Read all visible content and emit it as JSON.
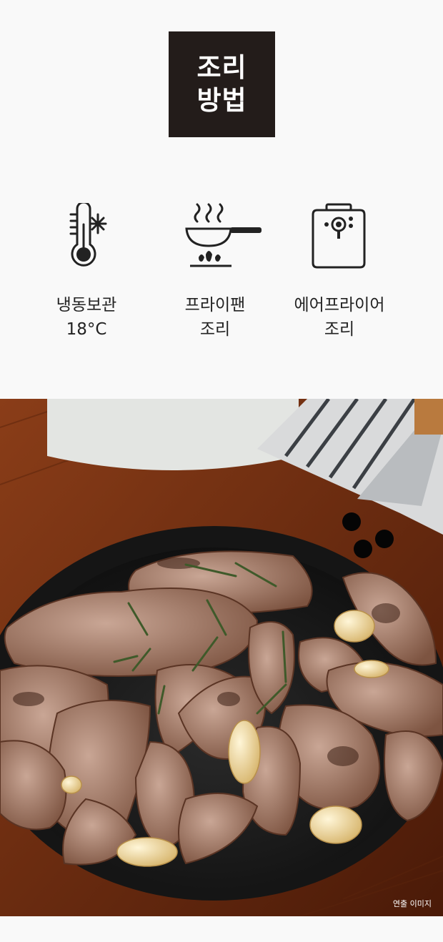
{
  "title": {
    "line1": "조리",
    "line2": "방법"
  },
  "methods": [
    {
      "icon": "thermometer-snowflake-icon",
      "line1": "냉동보관",
      "line2": "18°C"
    },
    {
      "icon": "frying-pan-icon",
      "line1": "프라이팬",
      "line2": "조리"
    },
    {
      "icon": "air-fryer-icon",
      "line1": "에어프라이어",
      "line2": "조리"
    }
  ],
  "photo": {
    "caption": "연출 이미지"
  },
  "colors": {
    "title_bg": "#231c1a",
    "page_bg": "#f9f9f9"
  }
}
